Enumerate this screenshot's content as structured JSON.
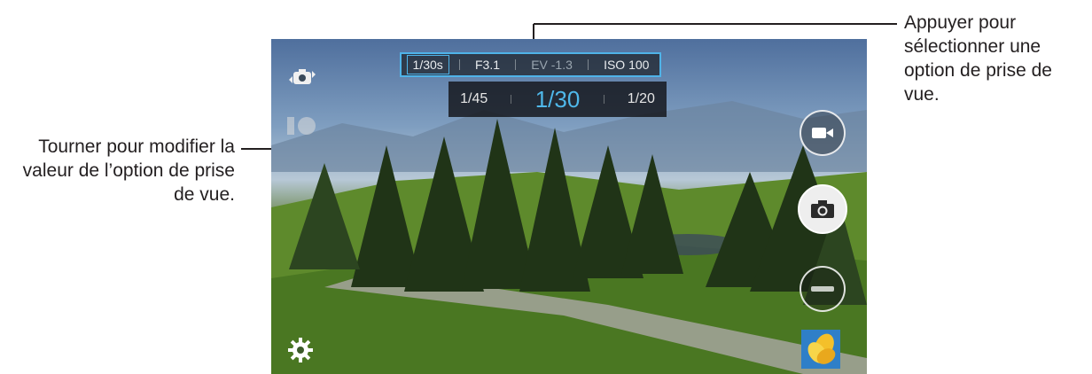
{
  "camera": {
    "top_bar": {
      "options": [
        {
          "label": "1/30s",
          "selected": true
        },
        {
          "label": "F3.1",
          "selected": false
        },
        {
          "label": "EV -1.3",
          "selected": false
        },
        {
          "label": "ISO 100",
          "selected": false
        }
      ]
    },
    "dial": {
      "prev_value": "1/45",
      "current_value": "1/30",
      "next_value": "1/20"
    },
    "icons": {
      "switch_camera": "camera-switch-icon",
      "mode": "shooting-mode-icon",
      "settings": "gear-icon",
      "video": "video-camera-icon",
      "shutter": "camera-icon",
      "gallery": "gallery-thumbnail"
    },
    "colors": {
      "accent": "#4fb8ea",
      "highlight_box": "#4fb3e8"
    }
  },
  "annotations": {
    "top_right": "Appuyer pour sélectionner une option de prise de vue.",
    "left": "Tourner pour modifier la valeur de l’option de prise de vue."
  }
}
